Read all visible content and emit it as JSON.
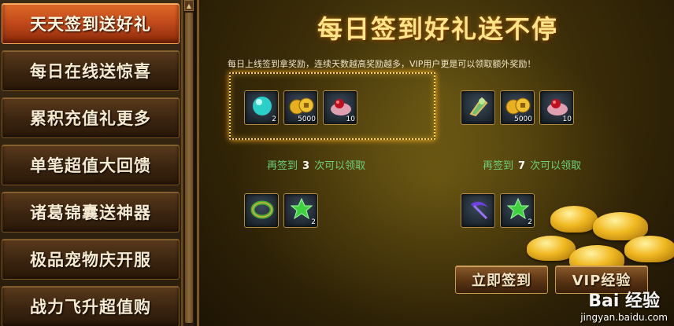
{
  "sidebar": {
    "items": [
      {
        "label": "天天签到送好礼",
        "active": true
      },
      {
        "label": "每日在线送惊喜",
        "active": false
      },
      {
        "label": "累积充值礼更多",
        "active": false
      },
      {
        "label": "单笔超值大回馈",
        "active": false
      },
      {
        "label": "诸葛锦囊送神器",
        "active": false
      },
      {
        "label": "极品宠物庆开服",
        "active": false
      },
      {
        "label": "战力飞升超值购",
        "active": false
      }
    ]
  },
  "main": {
    "title": "每日签到好礼送不停",
    "intro": "每日上线签到拿奖励，连续天数越高奖励越多，VIP用户更是可以领取额外奖励！",
    "left_group": {
      "top_items": [
        {
          "icon": "orb-icon",
          "count": "2"
        },
        {
          "icon": "gold-coins-icon",
          "count": "5000"
        },
        {
          "icon": "bag-icon",
          "count": "10"
        }
      ],
      "claim": {
        "prefix": "再签到",
        "days": "3",
        "suffix": "次可以领取"
      },
      "bottom_items": [
        {
          "icon": "ring-icon",
          "count": ""
        },
        {
          "icon": "green-star-icon",
          "count": "2"
        }
      ]
    },
    "right_group": {
      "top_items": [
        {
          "icon": "jade-pendant-icon",
          "count": ""
        },
        {
          "icon": "gold-coins-icon",
          "count": "5000"
        },
        {
          "icon": "bag-icon",
          "count": "10"
        }
      ],
      "claim": {
        "prefix": "再签到",
        "days": "7",
        "suffix": "次可以领取"
      },
      "bottom_items": [
        {
          "icon": "scythe-icon",
          "count": ""
        },
        {
          "icon": "green-star-icon",
          "count": "2"
        }
      ]
    },
    "buttons": {
      "sign_in": "立即签到",
      "vip": "VIP经验"
    }
  },
  "watermark": {
    "logo": "Bai 经验",
    "url": "jingyan.baidu.com"
  },
  "colors": {
    "active_tab": "#d0581e",
    "title_gold": "#ffe58a",
    "claim_green": "#6cd07a"
  }
}
